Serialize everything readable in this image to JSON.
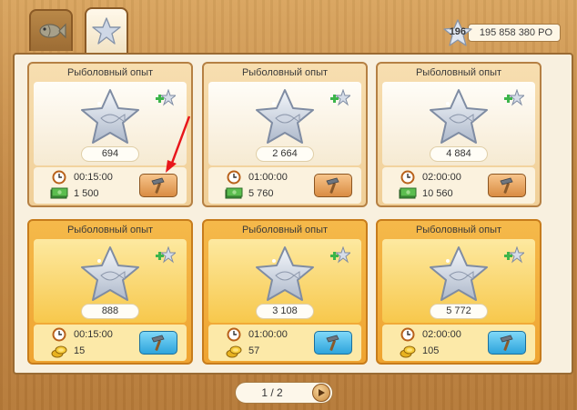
{
  "currency": {
    "level": "196",
    "value": "195 858 380 PO"
  },
  "cards": [
    {
      "title": "Рыболовный опыт",
      "amount": "694",
      "time": "00:15:00",
      "cost": "1 500",
      "cost_icon": "cash-icon",
      "style": "buy"
    },
    {
      "title": "Рыболовный опыт",
      "amount": "2 664",
      "time": "01:00:00",
      "cost": "5 760",
      "cost_icon": "cash-icon",
      "style": "buy"
    },
    {
      "title": "Рыболовный опыт",
      "amount": "4 884",
      "time": "02:00:00",
      "cost": "10 560",
      "cost_icon": "cash-icon",
      "style": "buy"
    },
    {
      "title": "Рыболовный опыт",
      "amount": "888",
      "time": "00:15:00",
      "cost": "15",
      "cost_icon": "gold-coins-icon",
      "style": "gold"
    },
    {
      "title": "Рыболовный опыт",
      "amount": "3 108",
      "time": "01:00:00",
      "cost": "57",
      "cost_icon": "gold-coins-icon",
      "style": "gold"
    },
    {
      "title": "Рыболовный опыт",
      "amount": "5 772",
      "time": "02:00:00",
      "cost": "105",
      "cost_icon": "gold-coins-icon",
      "style": "gold"
    }
  ],
  "pager": {
    "text": "1 / 2"
  },
  "colors": {
    "annotation_arrow": "#e8161b",
    "gold_card": "#f5b94a",
    "buy_card": "#f7deb0"
  }
}
